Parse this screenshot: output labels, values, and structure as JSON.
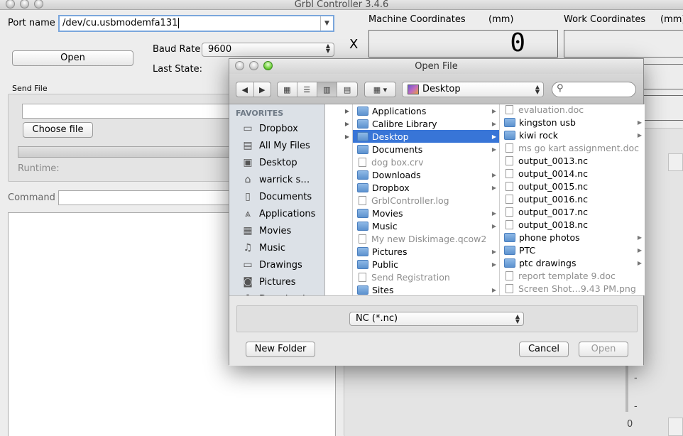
{
  "window": {
    "title": "Grbl Controller 3.4.6"
  },
  "main": {
    "port_label": "Port name",
    "port_value": "/dev/cu.usbmodemfa131",
    "open_button": "Open",
    "baud_label": "Baud Rate",
    "baud_value": "9600",
    "last_state_label": "Last State:",
    "axis_x": "X",
    "machine_coords_label": "Machine Coordinates",
    "mm_label_1": "(mm)",
    "work_coords_label": "Work Coordinates",
    "mm_label_2": "(mm)",
    "machine_x_value": "0",
    "send_file_label": "Send File",
    "choose_file_button": "Choose file",
    "runtime_label": "Runtime:",
    "command_label": "Command",
    "axis_tick_1": "-",
    "axis_tick_2": "-",
    "axis_zero": "0"
  },
  "dialog": {
    "title": "Open File",
    "location": "Desktop",
    "search_placeholder": "",
    "sidebar": {
      "header": "FAVORITES",
      "items": [
        {
          "label": "Dropbox",
          "icon": "folder-icon"
        },
        {
          "label": "All My Files",
          "icon": "all-files-icon"
        },
        {
          "label": "Desktop",
          "icon": "desktop-icon"
        },
        {
          "label": "warrick s…",
          "icon": "home-icon"
        },
        {
          "label": "Documents",
          "icon": "documents-icon"
        },
        {
          "label": "Applications",
          "icon": "applications-icon"
        },
        {
          "label": "Movies",
          "icon": "movies-icon"
        },
        {
          "label": "Music",
          "icon": "music-icon"
        },
        {
          "label": "Drawings",
          "icon": "folder-icon"
        },
        {
          "label": "Pictures",
          "icon": "pictures-icon"
        },
        {
          "label": "Downloads",
          "icon": "downloads-icon"
        }
      ]
    },
    "column_home": [
      {
        "has_chevron": true
      },
      {
        "has_chevron": true
      },
      {
        "has_chevron": true,
        "selected": true
      },
      {
        "has_chevron": false
      },
      {
        "has_chevron": false
      },
      {
        "has_chevron": false
      },
      {
        "has_chevron": false
      },
      {
        "has_chevron": false
      },
      {
        "has_chevron": false
      },
      {
        "has_chevron": false
      },
      {
        "has_chevron": false
      },
      {
        "has_chevron": false
      },
      {
        "has_chevron": false
      },
      {
        "has_chevron": false
      },
      {
        "has_chevron": false
      }
    ],
    "column_middle": [
      {
        "label": "Applications",
        "kind": "folder",
        "chevron": true
      },
      {
        "label": "Calibre Library",
        "kind": "folder",
        "chevron": true
      },
      {
        "label": "Desktop",
        "kind": "folder",
        "chevron": true,
        "selected": true
      },
      {
        "label": "Documents",
        "kind": "folder",
        "chevron": true
      },
      {
        "label": "dog box.crv",
        "kind": "file",
        "dim": true
      },
      {
        "label": "Downloads",
        "kind": "folder",
        "chevron": true
      },
      {
        "label": "Dropbox",
        "kind": "folder",
        "chevron": true
      },
      {
        "label": "GrblController.log",
        "kind": "file",
        "dim": true
      },
      {
        "label": "Movies",
        "kind": "folder",
        "chevron": true
      },
      {
        "label": "Music",
        "kind": "folder",
        "chevron": true
      },
      {
        "label": "My new Diskimage.qcow2",
        "kind": "file",
        "dim": true
      },
      {
        "label": "Pictures",
        "kind": "folder",
        "chevron": true
      },
      {
        "label": "Public",
        "kind": "folder",
        "chevron": true
      },
      {
        "label": "Send Registration",
        "kind": "file",
        "dim": true
      },
      {
        "label": "Sites",
        "kind": "folder",
        "chevron": true
      }
    ],
    "column_desktop": [
      {
        "label": "evaluation.doc",
        "kind": "file",
        "dim": true
      },
      {
        "label": "kingston usb",
        "kind": "folder",
        "chevron": true
      },
      {
        "label": "kiwi rock",
        "kind": "folder",
        "chevron": true
      },
      {
        "label": "ms go kart assignment.doc",
        "kind": "file",
        "dim": true
      },
      {
        "label": "output_0013.nc",
        "kind": "file"
      },
      {
        "label": "output_0014.nc",
        "kind": "file"
      },
      {
        "label": "output_0015.nc",
        "kind": "file"
      },
      {
        "label": "output_0016.nc",
        "kind": "file"
      },
      {
        "label": "output_0017.nc",
        "kind": "file"
      },
      {
        "label": "output_0018.nc",
        "kind": "file"
      },
      {
        "label": "phone photos",
        "kind": "folder",
        "chevron": true
      },
      {
        "label": "PTC",
        "kind": "folder",
        "chevron": true
      },
      {
        "label": "ptc drawings",
        "kind": "folder",
        "chevron": true
      },
      {
        "label": "report template 9.doc",
        "kind": "file",
        "dim": true
      },
      {
        "label": "Screen Shot…9.43 PM.png",
        "kind": "file",
        "dim": true
      }
    ],
    "filter_value": "NC (*.nc)",
    "new_folder_button": "New Folder",
    "cancel_button": "Cancel",
    "open_button": "Open"
  }
}
